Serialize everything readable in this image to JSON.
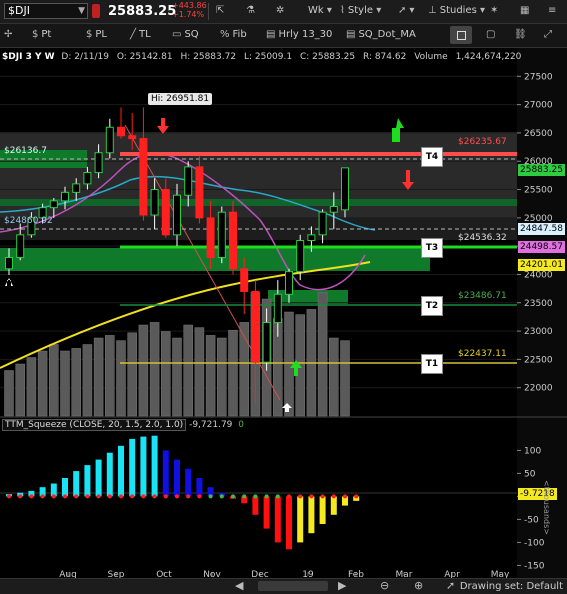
{
  "toolbar": {
    "symbol": "$DJI",
    "last_price": "25883.25",
    "change_abs": "+443.86",
    "change_pct": "+1.74%",
    "wk_label": "Wk",
    "style_label": "Style",
    "studies_label": "Studies"
  },
  "drawing_toolbar": {
    "pt_label": "Pt",
    "pl_label": "PL",
    "tl_label": "TL",
    "sq_label": "SQ",
    "fib_label": "Fib",
    "hrly_label": "Hrly 13_30",
    "sqdot_label": "SQ_Dot_MA"
  },
  "chart_header": {
    "symbol_period": "$DJI 3 Y W",
    "date": "D: 2/11/19",
    "open": "O: 25142.81",
    "high": "H: 25883.72",
    "low": "L: 25009.1",
    "close": "C: 25883.25",
    "range": "R: 874.62",
    "volume_label": "Volume",
    "volume_value": "1,424,674,220"
  },
  "annotations": {
    "high_marker": "Hi: 26951.81",
    "left_label_top": "$26136.7",
    "left_label_mid": "$24860.92",
    "t4": "T4",
    "t3": "T3",
    "t2": "T2",
    "t1": "T1",
    "t4_price": "$26235.67",
    "t3_price": "$24536.32",
    "t2_price": "$23486.71",
    "t1_price": "$22437.11"
  },
  "price_axis": {
    "ticks": [
      "27500",
      "27000",
      "26500",
      "26000",
      "25500",
      "25000",
      "24500",
      "24000",
      "23500",
      "23000",
      "22500",
      "22000"
    ],
    "tag_last": "25883.25",
    "tag_1": "24847.58",
    "tag_2": "24498.57",
    "tag_3": "24201.01"
  },
  "squeeze": {
    "title": "TTM_Squeeze (CLOSE, 20, 1.5, 2.0, 1.0)",
    "value": "-9,721.79",
    "zero": "0",
    "ticks": [
      "100",
      "50",
      "0",
      "-50",
      "-100",
      "-150"
    ],
    "tag": "-9.7218",
    "axis_unit": "<thousands>"
  },
  "time_axis": [
    "Aug",
    "Sep",
    "Oct",
    "Nov",
    "Dec",
    "19",
    "Feb",
    "Mar",
    "Apr",
    "May"
  ],
  "footer": {
    "drawing_set": "Drawing set: Default"
  },
  "colors": {
    "up": "#2ecc40",
    "down": "#ff2020",
    "target_red": "#ff4d4d",
    "target_green": "#1fdc1f",
    "sq_cyan": "#19e3f5",
    "sq_blue": "#1010e0",
    "sq_red": "#ff1010",
    "sq_yellow": "#f5ea20"
  },
  "chart_data": {
    "type": "candlestick",
    "interval": "Weekly",
    "candles": [
      {
        "o": 24100,
        "h": 24460,
        "l": 23990,
        "c": 24300
      },
      {
        "o": 24300,
        "h": 24900,
        "l": 24250,
        "c": 24700
      },
      {
        "o": 24700,
        "h": 25100,
        "l": 24650,
        "c": 25000
      },
      {
        "o": 25000,
        "h": 25250,
        "l": 24900,
        "c": 25180
      },
      {
        "o": 25180,
        "h": 25350,
        "l": 25000,
        "c": 25300
      },
      {
        "o": 25300,
        "h": 25550,
        "l": 25150,
        "c": 25450
      },
      {
        "o": 25450,
        "h": 25700,
        "l": 25300,
        "c": 25600
      },
      {
        "o": 25600,
        "h": 25900,
        "l": 25500,
        "c": 25800
      },
      {
        "o": 25800,
        "h": 26300,
        "l": 25700,
        "c": 26150
      },
      {
        "o": 26150,
        "h": 26750,
        "l": 26050,
        "c": 26600
      },
      {
        "o": 26600,
        "h": 26950,
        "l": 26400,
        "c": 26450
      },
      {
        "o": 26450,
        "h": 26850,
        "l": 26200,
        "c": 26400
      },
      {
        "o": 26400,
        "h": 26950,
        "l": 24950,
        "c": 25050
      },
      {
        "o": 25050,
        "h": 25700,
        "l": 24800,
        "c": 25500
      },
      {
        "o": 25500,
        "h": 25700,
        "l": 24650,
        "c": 24700
      },
      {
        "o": 24700,
        "h": 25600,
        "l": 24500,
        "c": 25400
      },
      {
        "o": 25400,
        "h": 26000,
        "l": 25200,
        "c": 25900
      },
      {
        "o": 25900,
        "h": 26100,
        "l": 24900,
        "c": 25000
      },
      {
        "o": 25000,
        "h": 25300,
        "l": 24100,
        "c": 24300
      },
      {
        "o": 24300,
        "h": 25200,
        "l": 24200,
        "c": 25100
      },
      {
        "o": 25100,
        "h": 25300,
        "l": 24000,
        "c": 24100
      },
      {
        "o": 24100,
        "h": 24300,
        "l": 23300,
        "c": 23700
      },
      {
        "o": 23700,
        "h": 23900,
        "l": 21700,
        "c": 22450
      },
      {
        "o": 22450,
        "h": 23400,
        "l": 22300,
        "c": 23150
      },
      {
        "o": 23150,
        "h": 23900,
        "l": 22900,
        "c": 23650
      },
      {
        "o": 23650,
        "h": 24100,
        "l": 23500,
        "c": 24050
      },
      {
        "o": 24050,
        "h": 24700,
        "l": 23900,
        "c": 24600
      },
      {
        "o": 24600,
        "h": 24850,
        "l": 24400,
        "c": 24700
      },
      {
        "o": 24700,
        "h": 25150,
        "l": 24550,
        "c": 25100
      },
      {
        "o": 25100,
        "h": 25450,
        "l": 24800,
        "c": 25200
      },
      {
        "o": 25142,
        "h": 25883,
        "l": 25009,
        "c": 25883
      }
    ],
    "volume_relative": [
      0.35,
      0.4,
      0.45,
      0.5,
      0.55,
      0.5,
      0.52,
      0.55,
      0.6,
      0.62,
      0.58,
      0.64,
      0.7,
      0.72,
      0.65,
      0.6,
      0.7,
      0.68,
      0.62,
      0.6,
      0.66,
      0.72,
      0.95,
      0.9,
      0.75,
      0.8,
      0.78,
      0.82,
      0.95,
      0.6,
      0.58
    ],
    "squeeze_histogram": [
      5,
      8,
      12,
      20,
      28,
      40,
      55,
      68,
      80,
      95,
      110,
      125,
      130,
      132,
      100,
      80,
      60,
      40,
      20,
      8,
      -5,
      -15,
      -40,
      -70,
      -100,
      -115,
      -100,
      -80,
      -60,
      -40,
      -20,
      -9.7218
    ],
    "y_range": [
      21500,
      28000
    ],
    "squeeze_range": [
      -160,
      140
    ]
  }
}
